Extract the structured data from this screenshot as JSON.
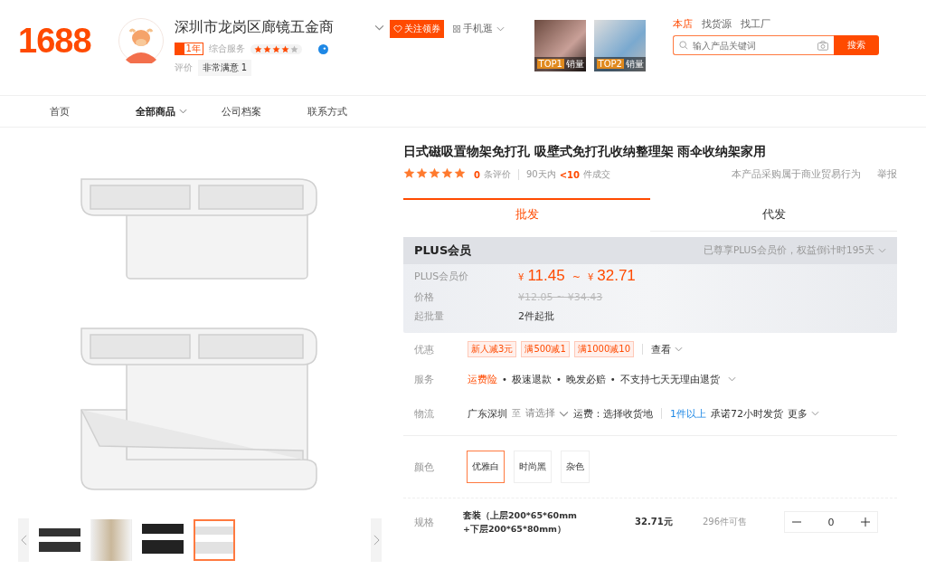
{
  "header": {
    "logo": "1688",
    "shop_name": "深圳市龙岗区廊镜五金商",
    "years": "1年",
    "service": {
      "label": "综合服务",
      "stars": 4
    },
    "rating_label": "评价",
    "rating_value": "非常满意 1",
    "follow_button": "关注领券",
    "mobile_link": "手机逛",
    "top_items": [
      {
        "badge": "TOP1",
        "label": "销量"
      },
      {
        "badge": "TOP2",
        "label": "销量"
      }
    ],
    "search_tabs": [
      {
        "label": "本店",
        "selected": true
      },
      {
        "label": "找货源",
        "selected": false
      },
      {
        "label": "找工厂",
        "selected": false
      }
    ],
    "search": {
      "placeholder": "输入产品关键词",
      "button": "搜索"
    }
  },
  "nav": [
    {
      "label": "首页",
      "selected": false,
      "has_menu": false
    },
    {
      "label": "全部商品",
      "selected": true,
      "has_menu": true
    },
    {
      "label": "公司档案",
      "selected": false,
      "has_menu": false
    },
    {
      "label": "联系方式",
      "selected": false,
      "has_menu": false
    }
  ],
  "gallery": {
    "thumbnails": [
      {
        "selected": false
      },
      {
        "selected": false
      },
      {
        "selected": false
      },
      {
        "selected": true
      }
    ]
  },
  "product": {
    "title": "日式磁吸置物架免打孔 吸壁式免打孔收纳整理架 雨伞收纳架家用",
    "stars": 5,
    "review_count": "0",
    "review_label": "条评价",
    "period": "90天内",
    "deals": "<10",
    "deals_label": "件成交",
    "notice": "本产品采购属于商业贸易行为",
    "report": "举报",
    "mode_tabs": [
      {
        "label": "批发",
        "selected": true
      },
      {
        "label": "代发",
        "selected": false
      }
    ],
    "plus": {
      "title": "PLUS会员",
      "note": "已尊享PLUS会员价，权益倒计时195天",
      "member_label": "PLUS会员价",
      "currency": "¥",
      "price_low": "11.45",
      "separator": "~",
      "price_high": "32.71",
      "price_label": "价格",
      "original_price": "¥12.05 ~ ¥34.43",
      "moq_label": "起批量",
      "moq": "2件起批"
    },
    "coupons": {
      "label": "优惠",
      "tags": [
        "新人减3元",
        "满500减1",
        "满1000减10"
      ],
      "link": "查看"
    },
    "services": {
      "label": "服务",
      "highlight": "运费险",
      "separator": "•",
      "items": [
        "极速退款",
        "晚发必赔",
        "不支持七天无理由退货"
      ]
    },
    "logistics": {
      "label": "物流",
      "from": "广东深圳",
      "to": "至",
      "select": "请选择",
      "fee": "运费：选择收货地",
      "quantity": "1件以上",
      "promise": "承诺72小时发货",
      "more": "更多"
    },
    "colors": {
      "label": "颜色",
      "options": [
        {
          "label": "优雅白",
          "selected": true
        },
        {
          "label": "时尚黑",
          "selected": false
        },
        {
          "label": "杂色",
          "selected": false
        }
      ]
    },
    "specs": {
      "label": "规格",
      "rows": [
        {
          "name_line1": "套装（上层200*65*60mm",
          "name_line2": "+下层200*65*80mm）",
          "price": "32.71元",
          "stock": "296件可售",
          "quantity": "0"
        }
      ]
    }
  }
}
